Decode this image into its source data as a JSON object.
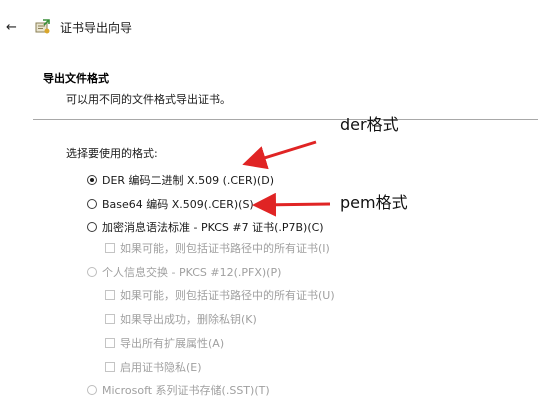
{
  "window": {
    "back_glyph": "←",
    "title": "证书导出向导"
  },
  "section": {
    "title": "导出文件格式",
    "description": "可以用不同的文件格式导出证书。"
  },
  "prompt": "选择要使用的格式:",
  "options": [
    {
      "label": "DER 编码二进制 X.509 (.CER)(D)",
      "checked": true,
      "enabled": true
    },
    {
      "label": "Base64 编码 X.509(.CER)(S)",
      "checked": false,
      "enabled": true
    },
    {
      "label": "加密消息语法标准 - PKCS #7 证书(.P7B)(C)",
      "checked": false,
      "enabled": true
    },
    {
      "label": "个人信息交换 - PKCS #12(.PFX)(P)",
      "checked": false,
      "enabled": false
    },
    {
      "label": "Microsoft 系列证书存储(.SST)(T)",
      "checked": false,
      "enabled": false
    }
  ],
  "pkcs7_checkbox": {
    "label": "如果可能，则包括证书路径中的所有证书(I)",
    "checked": false,
    "enabled": false
  },
  "pkcs12_checkboxes": [
    {
      "label": "如果可能，则包括证书路径中的所有证书(U)",
      "checked": false,
      "enabled": false
    },
    {
      "label": "如果导出成功，删除私钥(K)",
      "checked": false,
      "enabled": false
    },
    {
      "label": "导出所有扩展属性(A)",
      "checked": false,
      "enabled": false
    },
    {
      "label": "启用证书隐私(E)",
      "checked": false,
      "enabled": false
    }
  ],
  "annotations": {
    "der": "der格式",
    "pem": "pem格式",
    "arrow_color": "#e02424"
  }
}
